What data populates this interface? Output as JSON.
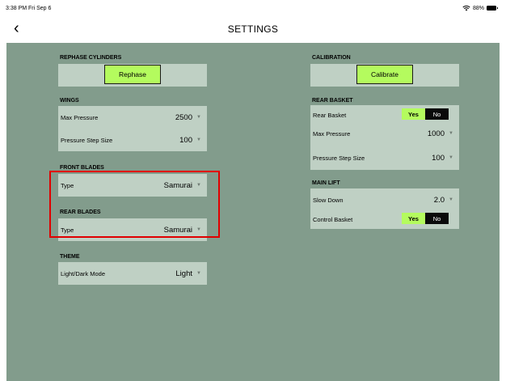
{
  "status": {
    "time": "3:38 PM  Fri Sep 6",
    "battery": "88%"
  },
  "nav": {
    "back_icon": "chevron-left-icon",
    "title": "SETTINGS"
  },
  "left": {
    "rephase": {
      "title": "REPHASE CYLINDERS",
      "button": "Rephase"
    },
    "wings": {
      "title": "WINGS",
      "max_pressure_label": "Max Pressure",
      "max_pressure_value": "2500",
      "step_label": "Pressure Step Size",
      "step_value": "100"
    },
    "front_blades": {
      "title": "FRONT BLADES",
      "type_label": "Type",
      "type_value": "Samurai"
    },
    "rear_blades": {
      "title": "REAR BLADES",
      "type_label": "Type",
      "type_value": "Samurai"
    },
    "theme": {
      "title": "THEME",
      "mode_label": "Light/Dark Mode",
      "mode_value": "Light"
    }
  },
  "right": {
    "calibration": {
      "title": "CALIBRATION",
      "button": "Calibrate"
    },
    "rear_basket": {
      "title": "REAR BASKET",
      "basket_label": "Rear Basket",
      "yes": "Yes",
      "no": "No",
      "max_pressure_label": "Max Pressure",
      "max_pressure_value": "1000",
      "step_label": "Pressure Step Size",
      "step_value": "100"
    },
    "main_lift": {
      "title": "MAIN LIFT",
      "slow_label": "Slow Down",
      "slow_value": "2.0",
      "control_label": "Control Basket",
      "yes": "Yes",
      "no": "No"
    }
  },
  "caret": "▼",
  "colors": {
    "panel": "#829c8c",
    "box": "#bfd0c4",
    "accent": "#b4fb5e",
    "highlight": "#e00000"
  }
}
